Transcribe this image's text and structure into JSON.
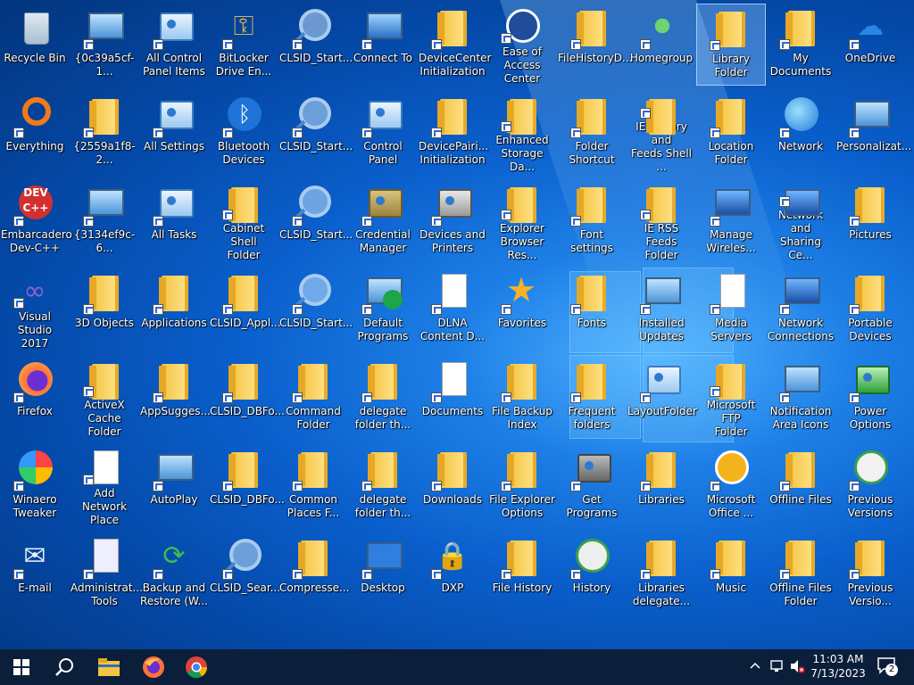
{
  "desktop": {
    "columns": [
      [
        "Recycle Bin",
        "Everything",
        "Embarcadero\nDev-C++",
        "Visual Studio\n2017",
        "Firefox",
        "Winaero\nTweaker",
        "E-mail"
      ],
      [
        "{0c39a5cf-1...",
        "{2559a1f8-2...",
        "{3134ef9c-6...",
        "3D Objects",
        "ActiveX\nCache Folder",
        "Add Network\nPlace",
        "Administrat...\nTools"
      ],
      [
        "All Control\nPanel Items",
        "All Settings",
        "All Tasks",
        "Applications",
        "AppSugges...",
        "AutoPlay",
        "Backup and\nRestore (W..."
      ],
      [
        "BitLocker\nDrive En...",
        "Bluetooth\nDevices",
        "Cabinet Shell\nFolder",
        "CLSID_Appl...",
        "CLSID_DBFo...",
        "CLSID_DBFo...",
        "CLSID_Sear..."
      ],
      [
        "CLSID_Start...",
        "CLSID_Start...",
        "CLSID_Start...",
        "CLSID_Start...",
        "Command\nFolder",
        "Common\nPlaces F...",
        "Compresse..."
      ],
      [
        "Connect To",
        "Control Panel",
        "Credential\nManager",
        "Default\nPrograms",
        "delegate\nfolder th...",
        "delegate\nfolder th...",
        "Desktop"
      ],
      [
        "DeviceCenter\nInitialization",
        "DevicePairi...\nInitialization",
        "Devices and\nPrinters",
        "DLNA\nContent D...",
        "Documents",
        "Downloads",
        "DXP"
      ],
      [
        "Ease of\nAccess Center",
        "Enhanced\nStorage Da...",
        "Explorer\nBrowser Res...",
        "Favorites",
        "File Backup\nIndex",
        "File Explorer\nOptions",
        "File History"
      ],
      [
        "FileHistoryD...",
        "Folder\nShortcut",
        "Font settings",
        "Fonts",
        "Frequent\nfolders",
        "Get Programs",
        "History"
      ],
      [
        "Homegroup",
        "IE History and\nFeeds Shell ...",
        "IE RSS Feeds\nFolder",
        "Installed\nUpdates",
        "LayoutFolder",
        "Libraries",
        "Libraries\ndelegate..."
      ],
      [
        "Library Folder",
        "Location\nFolder",
        "Manage\nWireles...",
        "Media Servers",
        "Microsoft FTP\nFolder",
        "Microsoft\nOffice ...",
        "Music"
      ],
      [
        "My\nDocuments",
        "Network",
        "Network and\nSharing Ce...",
        "Network\nConnections",
        "Notification\nArea Icons",
        "Offline Files",
        "Offline Files\nFolder"
      ],
      [
        "OneDrive",
        "Personalizat...",
        "Pictures",
        "Portable\nDevices",
        "Power\nOptions",
        "Previous\nVersions",
        "Previous\nVersio..."
      ]
    ],
    "glyph_types": [
      [
        "bin",
        "search-ring",
        "devcpp",
        "vs",
        "firefox",
        "winaero",
        "mail"
      ],
      [
        "monitor",
        "folder",
        "monitor",
        "folder",
        "folder",
        "page",
        "tools"
      ],
      [
        "panel",
        "panel",
        "panel",
        "folder",
        "folder",
        "monitor",
        "backup"
      ],
      [
        "keys",
        "bluetooth",
        "folder",
        "folder",
        "folder",
        "folder",
        "magnify"
      ],
      [
        "magnify",
        "magnify",
        "magnify",
        "magnify",
        "folder",
        "folder",
        "folder"
      ],
      [
        "connect",
        "panel",
        "safe",
        "default",
        "folder",
        "folder",
        "desktop"
      ],
      [
        "folder",
        "folder",
        "printer",
        "page",
        "page",
        "folder",
        "lock"
      ],
      [
        "ease",
        "folder",
        "folder",
        "star",
        "folder",
        "folder",
        "folder"
      ],
      [
        "folder",
        "folder",
        "folder",
        "folder",
        "folder",
        "programs",
        "history"
      ],
      [
        "homegroup",
        "folder",
        "folder",
        "monitor",
        "panel",
        "folder",
        "folder"
      ],
      [
        "folder",
        "folder",
        "network",
        "page",
        "folder",
        "office",
        "folder"
      ],
      [
        "folder",
        "globe",
        "network",
        "network",
        "monitor",
        "folder",
        "folder"
      ],
      [
        "cloud",
        "monitor",
        "folder",
        "folder",
        "battery",
        "clock",
        "folder"
      ]
    ],
    "selected": "Library Folder"
  },
  "taskbar": {
    "start_icon": "windows-start-icon",
    "search_icon": "search-icon",
    "pinned": [
      "file-explorer-icon",
      "firefox-icon",
      "chrome-icon"
    ],
    "time": "11:03 AM",
    "date": "7/13/2023",
    "notification_count": "2"
  },
  "colors": {
    "taskbar": "#0c1f3a",
    "wallpaper": "#0a5fcc",
    "folder": "#f4c542"
  }
}
